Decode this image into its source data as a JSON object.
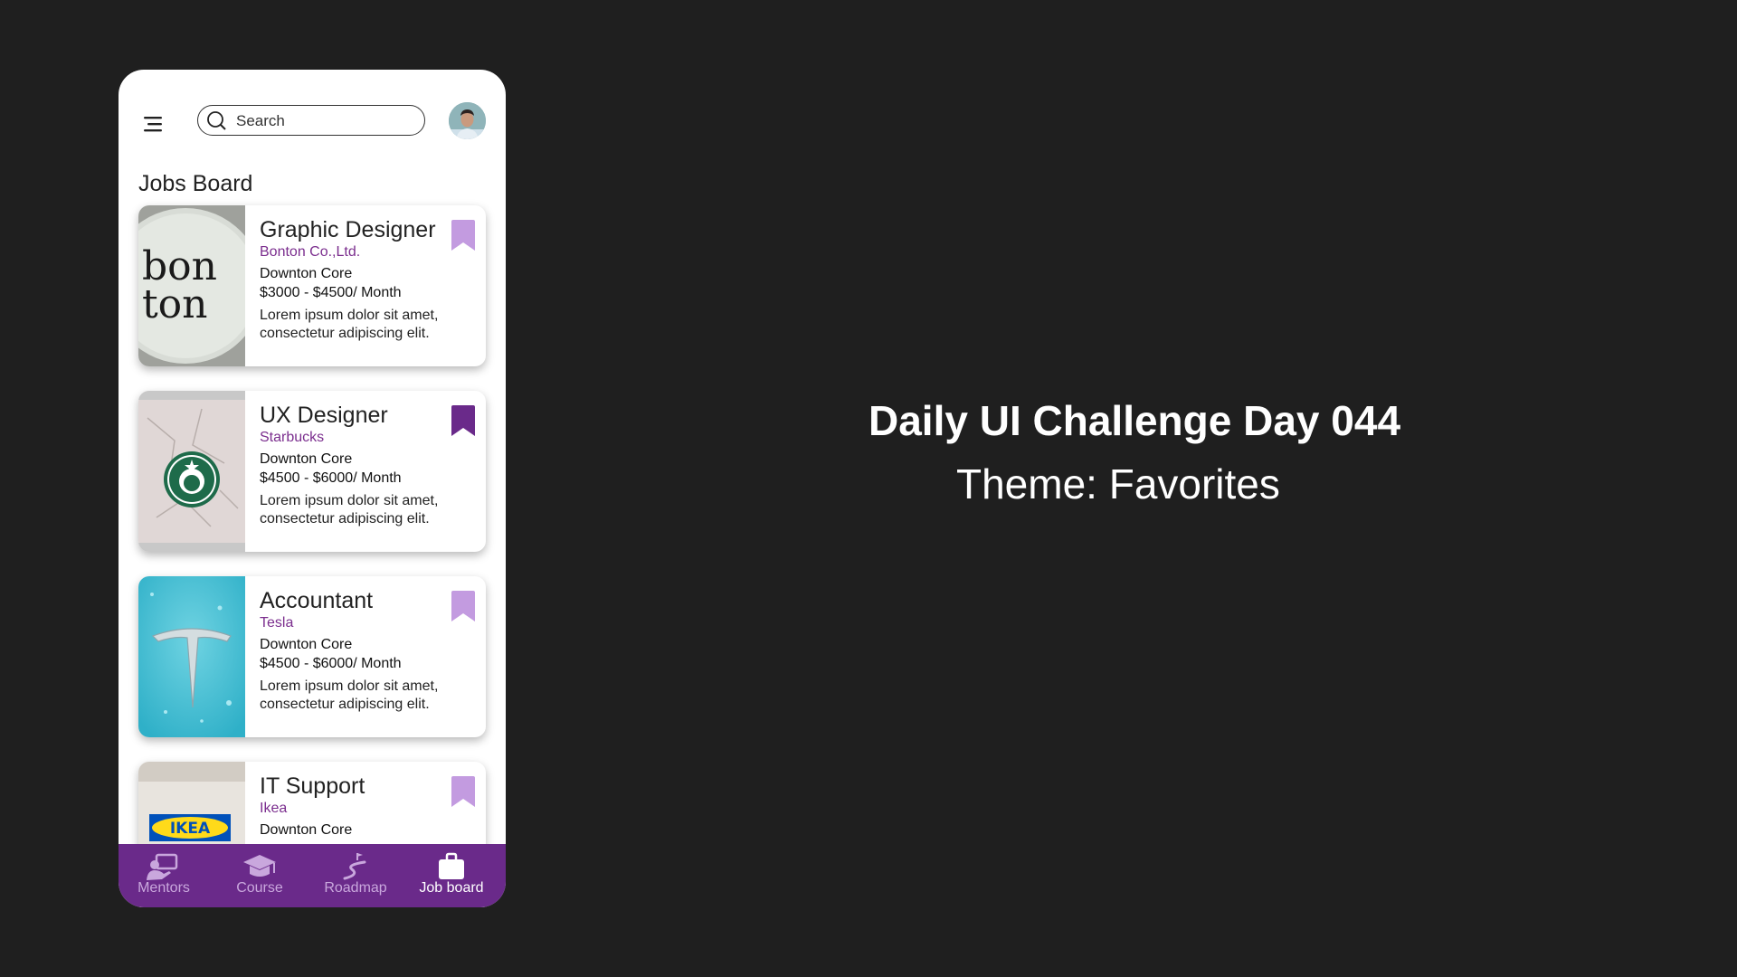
{
  "header": {
    "search_placeholder": "Search"
  },
  "section_title": "Jobs Board",
  "jobs": [
    {
      "title": "Graphic Designer",
      "company": "Bonton Co.,Ltd.",
      "location": "Downton Core",
      "salary": "$3000 - $4500/ Month",
      "description": "Lorem ipsum dolor sit amet, consectetur adipiscing elit.",
      "logo_text": "bon ton",
      "bookmarked": false
    },
    {
      "title": "UX Designer",
      "company": "Starbucks",
      "location": "Downton Core",
      "salary": "$4500 - $6000/ Month",
      "description": "Lorem ipsum dolor sit amet, consectetur adipiscing elit.",
      "bookmarked": true
    },
    {
      "title": "Accountant",
      "company": "Tesla",
      "location": "Downton Core",
      "salary": "$4500 - $6000/ Month",
      "description": "Lorem ipsum dolor sit amet, consectetur adipiscing elit.",
      "bookmarked": false
    },
    {
      "title": "IT Support",
      "company": "Ikea",
      "location": "Downton Core",
      "logo_text": "IKEA",
      "bookmarked": false
    }
  ],
  "nav": [
    {
      "label": "Mentors",
      "icon": "mentor-icon",
      "active": false
    },
    {
      "label": "Course",
      "icon": "graduation-cap-icon",
      "active": false
    },
    {
      "label": "Roadmap",
      "icon": "roadmap-icon",
      "active": false
    },
    {
      "label": "Job board",
      "icon": "briefcase-icon",
      "active": true
    }
  ],
  "headline": "Daily UI Challenge Day 044",
  "subheadline": "Theme: Favorites",
  "colors": {
    "accent": "#6a2a8a",
    "bookmark_active": "#6a2a8a",
    "bookmark_inactive": "#c39be0",
    "background": "#1f1f1f"
  }
}
